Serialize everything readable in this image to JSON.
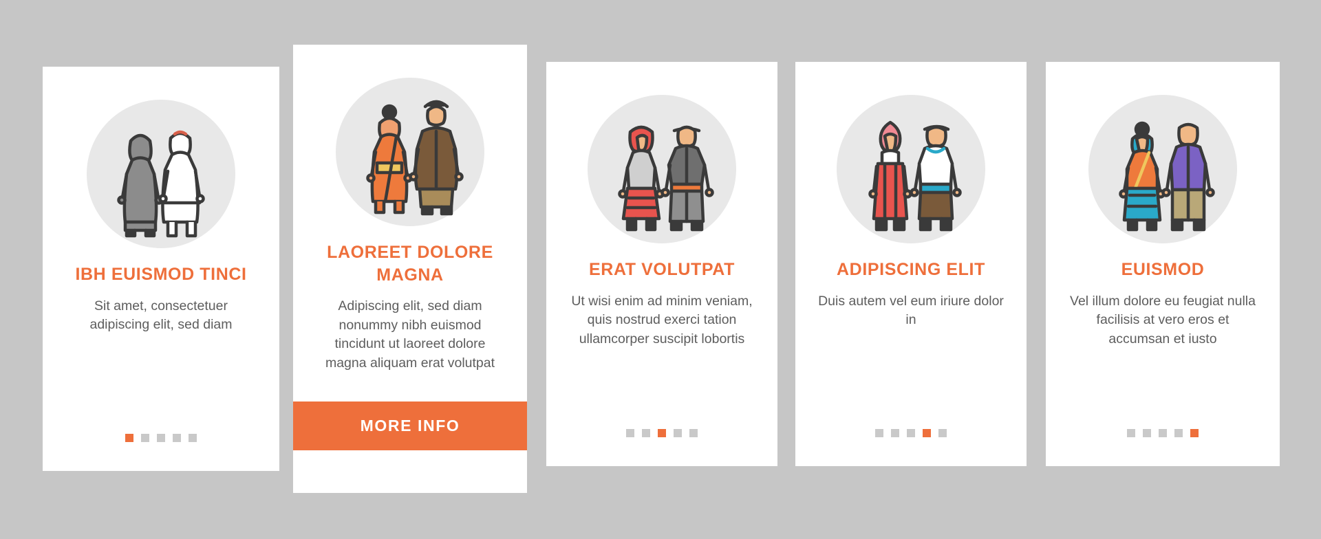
{
  "background_color": "#c6c6c6",
  "accent_color": "#ee6f3b",
  "card_color": "#ffffff",
  "disc_color": "#e8e8e8",
  "cards": [
    {
      "illustration": "two-people-traditional-clothing-gray-black-icon",
      "title": "IBH EUISMOD TINCI",
      "body": "Sit amet, consectetuer adipiscing elit, sed diam",
      "dots": {
        "count": 5,
        "active_index": 0
      },
      "cta": null
    },
    {
      "illustration": "two-people-traditional-clothing-orange-brown-icon",
      "title": "LAOREET DOLORE MAGNA",
      "body": "Adipiscing elit, sed diam nonummy nibh euismod tincidunt ut laoreet dolore magna aliquam erat volutpat",
      "dots": null,
      "cta": "MORE INFO"
    },
    {
      "illustration": "two-people-traditional-clothing-red-gray-icon",
      "title": "ERAT VOLUTPAT",
      "body": "Ut wisi enim ad minim veniam, quis nostrud exerci tation ullamcorper suscipit lobortis",
      "dots": {
        "count": 5,
        "active_index": 2
      },
      "cta": null
    },
    {
      "illustration": "two-people-traditional-clothing-pink-white-icon",
      "title": "ADIPISCING ELIT",
      "body": "Duis autem vel eum iriure dolor in",
      "dots": {
        "count": 5,
        "active_index": 3
      },
      "cta": null
    },
    {
      "illustration": "two-people-traditional-clothing-sari-purple-icon",
      "title": "EUISMOD",
      "body": "Vel illum dolore eu feugiat nulla facilisis at vero eros et accumsan et iusto",
      "dots": {
        "count": 5,
        "active_index": 4
      },
      "cta": null
    }
  ]
}
